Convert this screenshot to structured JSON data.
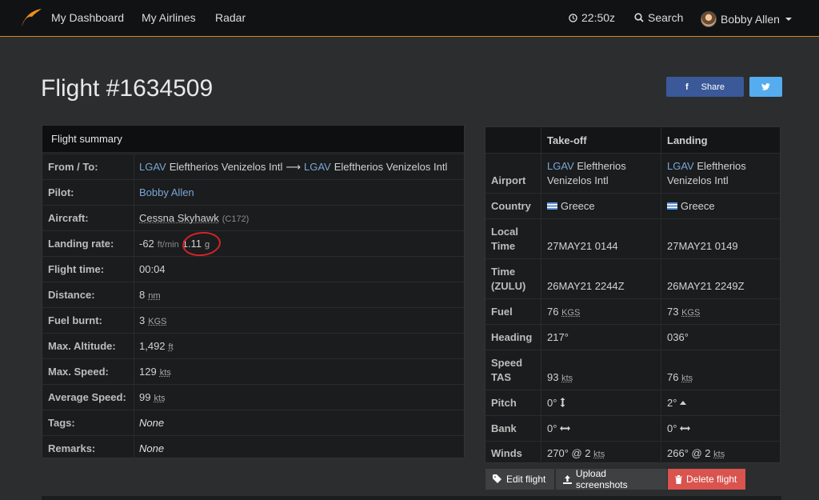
{
  "navbar": {
    "links": [
      "My Dashboard",
      "My Airlines",
      "Radar"
    ],
    "time": "22:50z",
    "search": "Search",
    "user": "Bobby Allen",
    "accent": "#d4891b"
  },
  "page": {
    "title": "Flight #1634509"
  },
  "share": {
    "facebook": "Share"
  },
  "summary": {
    "heading": "Flight summary",
    "from_to": {
      "label": "From / To:",
      "from_code": "LGAV",
      "from_name": "Eleftherios Venizelos Intl",
      "arrow": "⟶",
      "to_code": "LGAV",
      "to_name": "Eleftherios Venizelos Intl"
    },
    "pilot": {
      "label": "Pilot:",
      "value": "Bobby Allen"
    },
    "aircraft": {
      "label": "Aircraft:",
      "value": "Cessna Skyhawk",
      "code": "(C172)"
    },
    "landing_rate": {
      "label": "Landing rate:",
      "value": "-62",
      "unit": "ft/min",
      "g_value": "1.11",
      "g_unit": "g"
    },
    "flight_time": {
      "label": "Flight time:",
      "value": "00:04"
    },
    "distance": {
      "label": "Distance:",
      "value": "8",
      "unit": "nm"
    },
    "fuel_burnt": {
      "label": "Fuel burnt:",
      "value": "3",
      "unit": "KGS"
    },
    "max_altitude": {
      "label": "Max. Altitude:",
      "value": "1,492",
      "unit": "ft"
    },
    "max_speed": {
      "label": "Max. Speed:",
      "value": "129",
      "unit": "kts"
    },
    "avg_speed": {
      "label": "Average Speed:",
      "value": "99",
      "unit": "kts"
    },
    "tags": {
      "label": "Tags:",
      "value": "None"
    },
    "remarks": {
      "label": "Remarks:",
      "value": "None"
    }
  },
  "tl": {
    "h_takeoff": "Take-off",
    "h_landing": "Landing",
    "airport": {
      "label": "Airport",
      "t_code": "LGAV",
      "t_name": "Eleftherios",
      "t_name2": "Venizelos Intl",
      "l_code": "LGAV",
      "l_name": "Eleftherios",
      "l_name2": "Venizelos Intl"
    },
    "country": {
      "label": "Country",
      "t": "Greece",
      "l": "Greece"
    },
    "local_time": {
      "label1": "Local",
      "label2": "Time",
      "t": "27MAY21 0144",
      "l": "27MAY21 0149"
    },
    "zulu_time": {
      "label1": "Time",
      "label2": "(ZULU)",
      "t": "26MAY21 2244Z",
      "l": "26MAY21 2249Z"
    },
    "fuel": {
      "label": "Fuel",
      "t": "76",
      "l": "73",
      "unit": "KGS"
    },
    "heading": {
      "label": "Heading",
      "t": "217°",
      "l": "036°"
    },
    "speed": {
      "label1": "Speed",
      "label2": "TAS",
      "t": "93",
      "l": "76",
      "unit": "kts"
    },
    "pitch": {
      "label": "Pitch",
      "t": "0°",
      "l": "2°"
    },
    "bank": {
      "label": "Bank",
      "t": "0°",
      "l": "0°"
    },
    "winds": {
      "label": "Winds",
      "t": "270° @ 2",
      "l": "266° @ 2",
      "unit": "kts"
    }
  },
  "actions": {
    "edit": "Edit flight",
    "upload": "Upload screenshots",
    "delete": "Delete flight"
  }
}
